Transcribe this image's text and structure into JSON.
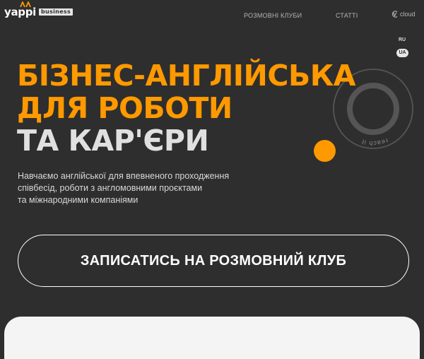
{
  "header": {
    "logo": {
      "name": "yappi",
      "badge": "business"
    },
    "nav": [
      {
        "label": "РОЗМОВНІ КЛУБИ"
      },
      {
        "label": "СТАТТІ"
      }
    ],
    "cloud_label": "cloud"
  },
  "lang_switcher": {
    "ru": "RU",
    "ua": "UA",
    "active": "UA"
  },
  "decoration": {
    "circle_text": "reach it"
  },
  "hero": {
    "title_lines": [
      "БІЗНЕС-АНГЛІЙСЬКА",
      "ДЛЯ РОБОТИ",
      "ТА КАР'ЄРИ"
    ],
    "description_lines": [
      "Навчаємо англійської для впевненого проходження",
      "співбесід, роботи з англомовними проєктами",
      "та міжнародними компаніями"
    ],
    "cta_label": "ЗАПИСАТИСЬ НА РОЗМОВНИЙ КЛУБ"
  },
  "colors": {
    "background": "#2e2e2e",
    "accent": "#ff9900",
    "text": "#ffffff",
    "panel": "#f4f4f4"
  }
}
